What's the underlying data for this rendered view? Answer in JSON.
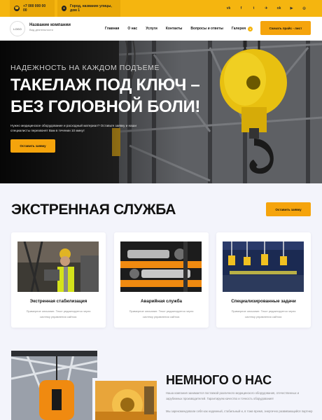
{
  "topbar": {
    "phone": "+7 000 000 00 00",
    "address": "Город, название улицы, дом 1",
    "socials": [
      "vk-icon",
      "facebook-icon",
      "twitter-icon",
      "telegram-icon",
      "odnoklassniki-icon",
      "youtube-icon",
      "instagram-icon"
    ]
  },
  "header": {
    "logo": "LOGO",
    "company_name": "Название компании",
    "company_sub": "Вид деятельности",
    "nav": [
      "Главная",
      "О нас",
      "Услуги",
      "Контакты",
      "Вопросы и ответы",
      "Галерея"
    ],
    "price_button": "Скачать прайс - лист"
  },
  "hero": {
    "subtitle": "НАДЕЖНОСТЬ НА КАЖДОМ ПОДЪЕМЕ",
    "title_line1": "ТАКЕЛАЖ ПОД КЛЮЧ –",
    "title_line2": "БЕЗ ГОЛОВНОЙ БОЛИ!",
    "description": "Нужно медицинское оборудование и расходный материал? Оставьте заявку и наши специалисты перезвонят Вам в течении 10 минут",
    "button": "Оставить заявку"
  },
  "emergency": {
    "title": "ЭКСТРЕННАЯ СЛУЖБА",
    "button": "Оставить заявку",
    "cards": [
      {
        "title": "Экстренная стабилизация",
        "text": "Примерное описание. Текст редактируется через систему управления сайтом."
      },
      {
        "title": "Аварийная служба",
        "text": "Примерное описание. Текст редактируется через систему управления сайтом."
      },
      {
        "title": "Специализированные задачи",
        "text": "Примерное описание. Текст редактируется через систему управления сайтом."
      }
    ]
  },
  "about": {
    "title": "НЕМНОГО О НАС",
    "p1": "Наша компания занимается поставкой различного медицинского оборудования, отечественных и зарубежных производителей. Гарантируем качество и точность оборудования!",
    "p2": "Мы зарекомендовали себя как надежный, стабильный и, в тоже время, энергично развивающийся партнер"
  },
  "colors": {
    "accent": "#f5a40c",
    "topbar": "#f5b50f",
    "background": "#f3f4fb"
  }
}
